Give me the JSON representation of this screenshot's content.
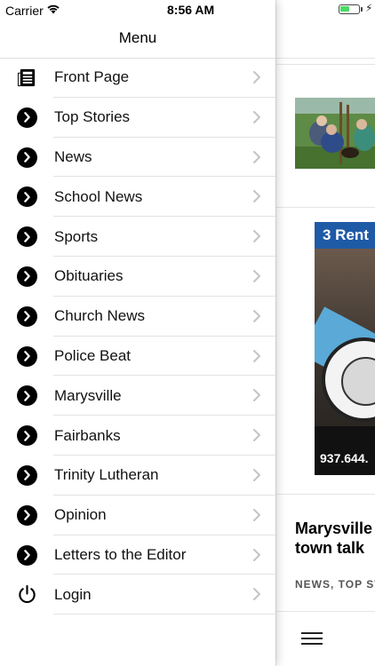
{
  "status": {
    "carrier": "Carrier",
    "time": "8:56 AM",
    "battery_level": 0.55
  },
  "menu": {
    "title": "Menu",
    "items": [
      {
        "label": "Front Page",
        "icon": "newspaper-icon"
      },
      {
        "label": "Top Stories",
        "icon": "chevron-circle-icon"
      },
      {
        "label": "News",
        "icon": "chevron-circle-icon"
      },
      {
        "label": "School News",
        "icon": "chevron-circle-icon"
      },
      {
        "label": "Sports",
        "icon": "chevron-circle-icon"
      },
      {
        "label": "Obituaries",
        "icon": "chevron-circle-icon"
      },
      {
        "label": "Church News",
        "icon": "chevron-circle-icon"
      },
      {
        "label": "Police Beat",
        "icon": "chevron-circle-icon"
      },
      {
        "label": "Marysville",
        "icon": "chevron-circle-icon"
      },
      {
        "label": "Fairbanks",
        "icon": "chevron-circle-icon"
      },
      {
        "label": "Trinity Lutheran",
        "icon": "chevron-circle-icon"
      },
      {
        "label": "Opinion",
        "icon": "chevron-circle-icon"
      },
      {
        "label": "Letters to the Editor",
        "icon": "chevron-circle-icon"
      },
      {
        "label": "Login",
        "icon": "power-icon"
      }
    ]
  },
  "content": {
    "ad_top_text": "3 Rent",
    "ad_phone": "937.644.",
    "headline_line1": "Marysville",
    "headline_line2": "town talk",
    "tags": "NEWS, TOP STORIES"
  },
  "colors": {
    "accent_ad": "#1f5aa6",
    "battery": "#4cd964"
  }
}
